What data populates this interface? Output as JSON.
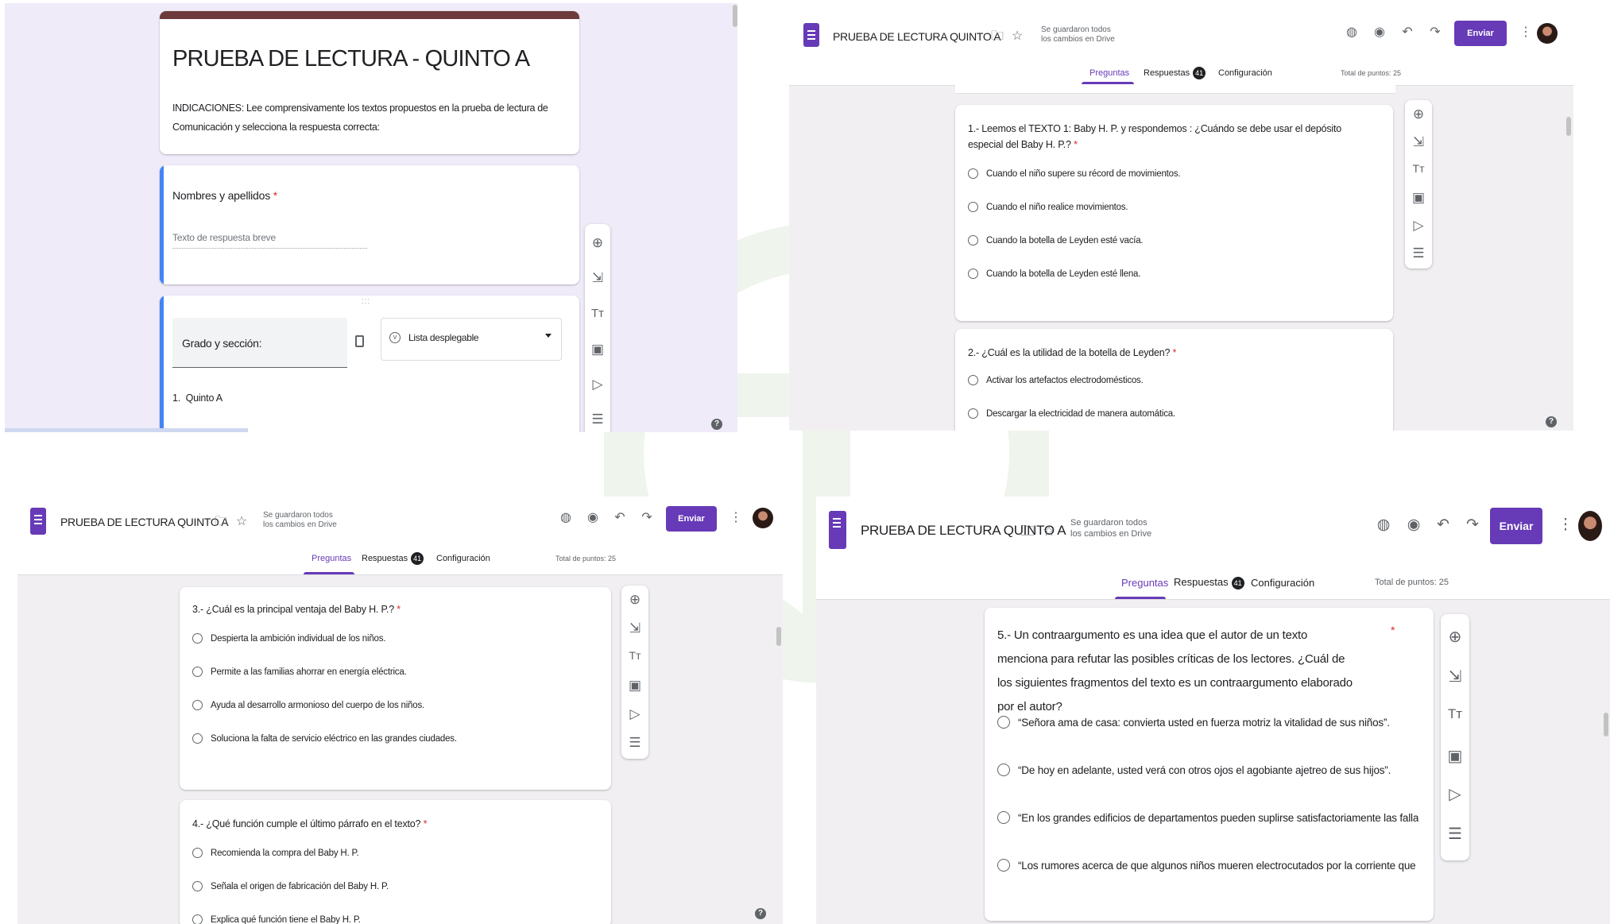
{
  "form_title_full": "PRUEBA DE LECTURA - QUINTO A",
  "indications": "INDICACIONES:  Lee comprensivamente los textos propuestos en  la prueba de lectura de Comunicación y selecciona la respuesta correcta:",
  "name_question": "Nombres y apellidos",
  "required_mark": "*",
  "short_answer_placeholder": "Texto de respuesta breve",
  "grade_question": "Grado y sección:",
  "dropdown_type": "Lista desplegable",
  "dropdown_option_number": "1.",
  "dropdown_option": "Quinto A",
  "drag_handle": ":::",
  "header": {
    "title": "PRUEBA DE LECTURA QUINTO A",
    "saved_status": "Se guardaron todos los cambios en Drive",
    "send_label": "Enviar",
    "more_icon": "⋮"
  },
  "tabs": {
    "questions": "Preguntas",
    "responses": "Respuestas",
    "responses_count": "41",
    "settings": "Configuración"
  },
  "total_points": "Total de puntos: 25",
  "help_label": "?",
  "toolbar_icons": [
    "add-question-icon",
    "import-questions-icon",
    "add-title-icon",
    "add-image-icon",
    "add-video-icon",
    "add-section-icon"
  ],
  "questions": [
    {
      "text": "1.- Leemos el TEXTO 1: Baby H. P. y respondemos : ¿Cuándo se debe usar el depósito especial del Baby H. P.?",
      "options": [
        "Cuando el niño supere su récord de movimientos.",
        "Cuando el niño realice movimientos.",
        "Cuando la botella de Leyden esté vacía.",
        "Cuando la botella de Leyden esté llena."
      ]
    },
    {
      "text": "2.- ¿Cuál es la utilidad de la botella de Leyden?",
      "options": [
        "Activar los artefactos electrodomésticos.",
        "Descargar la electricidad de manera automática."
      ]
    },
    {
      "text": "3.- ¿Cuál es la principal ventaja del Baby H. P.?",
      "options": [
        "Despierta la ambición individual de los niños.",
        "Permite a las familias ahorrar en energía eléctrica.",
        "Ayuda al desarrollo armonioso del cuerpo de los niños.",
        "Soluciona la falta de servicio eléctrico en las grandes ciudades."
      ]
    },
    {
      "text": "4.- ¿Qué función cumple el último párrafo en el texto?",
      "options": [
        "Recomienda la compra del Baby H. P.",
        "Señala el origen de fabricación del Baby H. P.",
        "Explica qué función tiene el Baby H. P."
      ]
    },
    {
      "text": "5.- Un contraargumento es una idea que el autor de un texto menciona para refutar las posibles críticas de los lectores. ¿Cuál de los siguientes fragmentos del texto es un contraargumento elaborado por el autor?",
      "options": [
        "“Señora ama de casa: convierta usted en fuerza motriz la vitalidad de sus niños”.",
        "“De hoy en adelante, usted verá con otros ojos el agobiante ajetreo de sus hijos”.",
        "“En los grandes edificios de departamentos pueden suplirse satisfactoriamente las fallas del servicio pú...",
        "“Los rumores acerca de que algunos niños mueren electrocutados por la corriente que ellos mismos gen..."
      ]
    }
  ],
  "colors": {
    "accent": "#673ab7",
    "header_bar": "#6d3b3b",
    "focus_bar": "#4285f4",
    "required": "#d93025"
  }
}
